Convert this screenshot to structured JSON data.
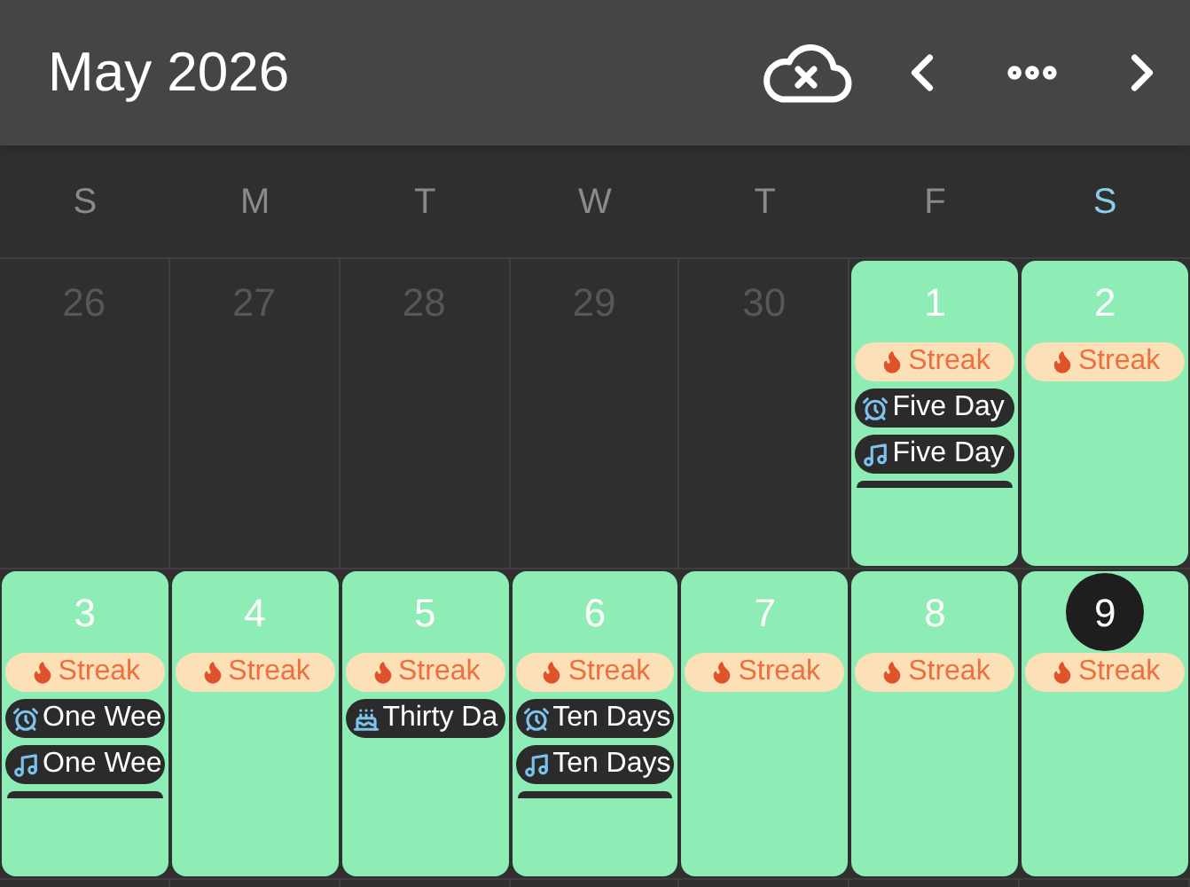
{
  "header": {
    "title": "May 2026"
  },
  "weekdays": [
    {
      "label": "S",
      "highlighted": false
    },
    {
      "label": "M",
      "highlighted": false
    },
    {
      "label": "T",
      "highlighted": false
    },
    {
      "label": "W",
      "highlighted": false
    },
    {
      "label": "T",
      "highlighted": false
    },
    {
      "label": "F",
      "highlighted": false
    },
    {
      "label": "S",
      "highlighted": true
    }
  ],
  "weeks": [
    {
      "days": [
        {
          "day": "26",
          "in_month": false
        },
        {
          "day": "27",
          "in_month": false
        },
        {
          "day": "28",
          "in_month": false
        },
        {
          "day": "29",
          "in_month": false
        },
        {
          "day": "30",
          "in_month": false
        },
        {
          "day": "1",
          "in_month": true,
          "today": false,
          "more": true,
          "events": [
            {
              "kind": "streak",
              "label": "Streak"
            },
            {
              "kind": "alarm",
              "label": "Five Day"
            },
            {
              "kind": "music",
              "label": "Five Day"
            }
          ]
        },
        {
          "day": "2",
          "in_month": true,
          "today": false,
          "more": false,
          "events": [
            {
              "kind": "streak",
              "label": "Streak"
            }
          ]
        }
      ]
    },
    {
      "days": [
        {
          "day": "3",
          "in_month": true,
          "today": false,
          "more": true,
          "events": [
            {
              "kind": "streak",
              "label": "Streak"
            },
            {
              "kind": "alarm",
              "label": "One Wee"
            },
            {
              "kind": "music",
              "label": "One Wee"
            }
          ]
        },
        {
          "day": "4",
          "in_month": true,
          "today": false,
          "more": false,
          "events": [
            {
              "kind": "streak",
              "label": "Streak"
            }
          ]
        },
        {
          "day": "5",
          "in_month": true,
          "today": false,
          "more": false,
          "events": [
            {
              "kind": "streak",
              "label": "Streak"
            },
            {
              "kind": "cake",
              "label": "Thirty Da"
            }
          ]
        },
        {
          "day": "6",
          "in_month": true,
          "today": false,
          "more": true,
          "events": [
            {
              "kind": "streak",
              "label": "Streak"
            },
            {
              "kind": "alarm",
              "label": "Ten Days"
            },
            {
              "kind": "music",
              "label": "Ten Days"
            }
          ]
        },
        {
          "day": "7",
          "in_month": true,
          "today": false,
          "more": false,
          "events": [
            {
              "kind": "streak",
              "label": "Streak"
            }
          ]
        },
        {
          "day": "8",
          "in_month": true,
          "today": false,
          "more": false,
          "events": [
            {
              "kind": "streak",
              "label": "Streak"
            }
          ]
        },
        {
          "day": "9",
          "in_month": true,
          "today": true,
          "more": false,
          "events": [
            {
              "kind": "streak",
              "label": "Streak"
            }
          ]
        }
      ]
    }
  ]
}
